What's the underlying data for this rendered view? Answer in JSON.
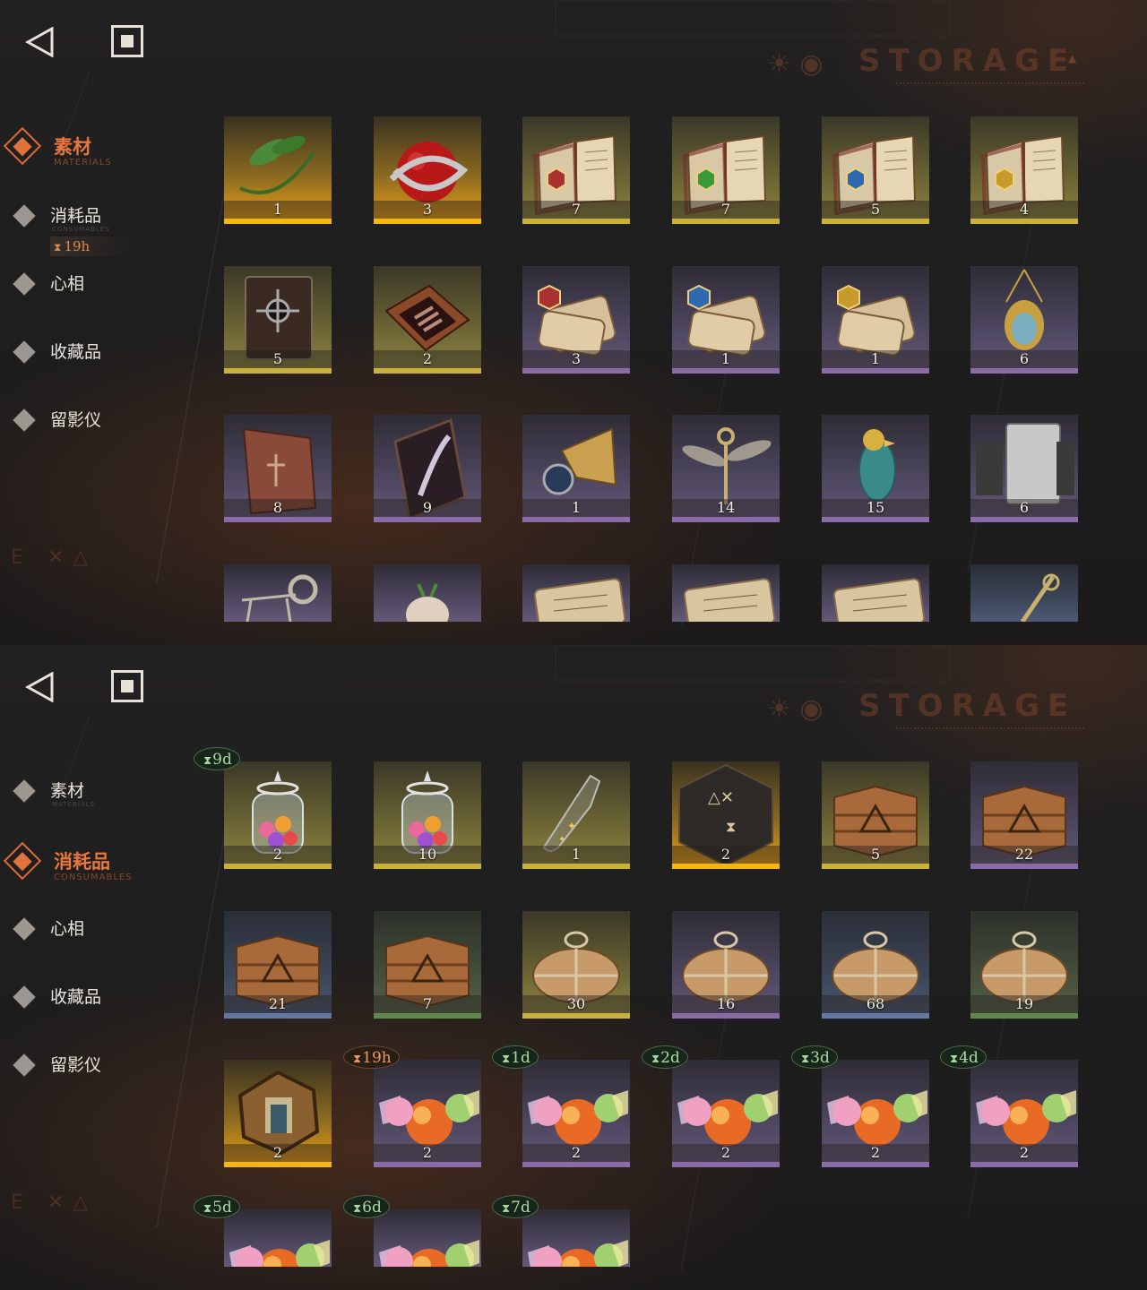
{
  "nav": {
    "back_icon": "back-triangle-icon",
    "home_icon": "home-square-icon"
  },
  "header": {
    "title": "STORAGE"
  },
  "screens": [
    {
      "sidebar": [
        {
          "label": "素材",
          "sub": "MATERIALS",
          "active": true
        },
        {
          "label": "消耗品",
          "sub": "CONSUMABLES",
          "active": false
        },
        {
          "label": "心相",
          "sub": "",
          "active": false
        },
        {
          "label": "收藏品",
          "sub": "",
          "active": false
        },
        {
          "label": "留影仪",
          "sub": "",
          "active": false
        }
      ],
      "sidebar_timer": "19h",
      "items": [
        {
          "name": "laurel-branch",
          "count": "1",
          "rarity": "gold"
        },
        {
          "name": "apple-serpent",
          "count": "3",
          "rarity": "gold"
        },
        {
          "name": "spellbook-red",
          "count": "7",
          "rarity": "yellow"
        },
        {
          "name": "spellbook-green",
          "count": "7",
          "rarity": "yellow"
        },
        {
          "name": "spellbook-blue",
          "count": "5",
          "rarity": "yellow"
        },
        {
          "name": "spellbook-gold",
          "count": "4",
          "rarity": "yellow"
        },
        {
          "name": "dark-tome",
          "count": "5",
          "rarity": "yellow"
        },
        {
          "name": "hand-case",
          "count": "2",
          "rarity": "yellow"
        },
        {
          "name": "scroll-red",
          "count": "3",
          "rarity": "purple"
        },
        {
          "name": "scroll-blue",
          "count": "1",
          "rarity": "purple"
        },
        {
          "name": "scroll-gold",
          "count": "1",
          "rarity": "purple"
        },
        {
          "name": "scarab-amulet",
          "count": "6",
          "rarity": "purple"
        },
        {
          "name": "clay-tablet",
          "count": "8",
          "rarity": "purple"
        },
        {
          "name": "feather-frame",
          "count": "9",
          "rarity": "purple"
        },
        {
          "name": "orb-gauntlet",
          "count": "1",
          "rarity": "purple"
        },
        {
          "name": "winged-key",
          "count": "14",
          "rarity": "purple"
        },
        {
          "name": "glass-bird",
          "count": "15",
          "rarity": "purple"
        },
        {
          "name": "silver-ingots",
          "count": "6",
          "rarity": "purple"
        },
        {
          "name": "ram-skeleton",
          "count": "",
          "rarity": "purple"
        },
        {
          "name": "mandrake",
          "count": "",
          "rarity": "purple"
        },
        {
          "name": "letter-scroll-1",
          "count": "",
          "rarity": "purple"
        },
        {
          "name": "letter-scroll-2",
          "count": "",
          "rarity": "purple"
        },
        {
          "name": "letter-scroll-3",
          "count": "",
          "rarity": "purple"
        },
        {
          "name": "ornate-staff",
          "count": "",
          "rarity": "blue"
        }
      ]
    },
    {
      "sidebar": [
        {
          "label": "素材",
          "sub": "MATERIALS",
          "active": false
        },
        {
          "label": "消耗品",
          "sub": "CONSUMABLES",
          "active": true
        },
        {
          "label": "心相",
          "sub": "",
          "active": false
        },
        {
          "label": "收藏品",
          "sub": "",
          "active": false
        },
        {
          "label": "留影仪",
          "sub": "",
          "active": false
        }
      ],
      "items": [
        {
          "name": "candy-jar",
          "count": "2",
          "rarity": "yellow",
          "timer": "9d",
          "timer_color": "green"
        },
        {
          "name": "candy-jar",
          "count": "10",
          "rarity": "yellow"
        },
        {
          "name": "bottle-moths",
          "count": "1",
          "rarity": "yellow"
        },
        {
          "name": "rune-cube",
          "count": "2",
          "rarity": "gold"
        },
        {
          "name": "wooden-crate",
          "count": "5",
          "rarity": "yellow"
        },
        {
          "name": "wooden-crate",
          "count": "22",
          "rarity": "purple"
        },
        {
          "name": "wooden-crate",
          "count": "21",
          "rarity": "blue"
        },
        {
          "name": "wooden-crate",
          "count": "7",
          "rarity": "green"
        },
        {
          "name": "paper-bundle",
          "count": "30",
          "rarity": "yellow"
        },
        {
          "name": "paper-bundle",
          "count": "16",
          "rarity": "purple"
        },
        {
          "name": "paper-bundle",
          "count": "68",
          "rarity": "blue"
        },
        {
          "name": "paper-bundle",
          "count": "19",
          "rarity": "green"
        },
        {
          "name": "hex-badge",
          "count": "2",
          "rarity": "gold"
        },
        {
          "name": "wrapped-candies",
          "count": "2",
          "rarity": "purple",
          "timer": "19h",
          "timer_color": "orange"
        },
        {
          "name": "wrapped-candies",
          "count": "2",
          "rarity": "purple",
          "timer": "1d",
          "timer_color": "green"
        },
        {
          "name": "wrapped-candies",
          "count": "2",
          "rarity": "purple",
          "timer": "2d",
          "timer_color": "green"
        },
        {
          "name": "wrapped-candies",
          "count": "2",
          "rarity": "purple",
          "timer": "3d",
          "timer_color": "green"
        },
        {
          "name": "wrapped-candies",
          "count": "2",
          "rarity": "purple",
          "timer": "4d",
          "timer_color": "green"
        },
        {
          "name": "wrapped-candies",
          "count": "",
          "rarity": "purple",
          "timer": "5d",
          "timer_color": "green"
        },
        {
          "name": "wrapped-candies",
          "count": "",
          "rarity": "purple",
          "timer": "6d",
          "timer_color": "green"
        },
        {
          "name": "wrapped-candies",
          "count": "",
          "rarity": "purple",
          "timer": "7d",
          "timer_color": "green"
        }
      ]
    }
  ]
}
